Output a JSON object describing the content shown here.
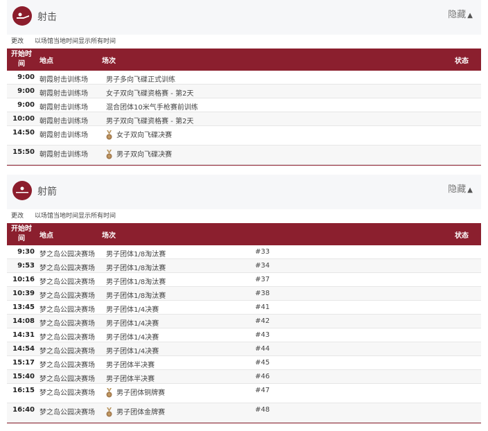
{
  "colors": {
    "accent": "#8b1f2e",
    "medal": "#a27a4e"
  },
  "sections": [
    {
      "id": "shooting",
      "title": "射击",
      "icon": "shooting-icon",
      "hide_label": "隐藏",
      "change_label": "更改",
      "timezone_note": "以场馆当地时间显示所有时间",
      "headers": {
        "time": "开始时间",
        "venue": "地点",
        "event": "场次",
        "status": "状态"
      },
      "rows": [
        {
          "time": "9:00",
          "venue": "朝霞射击训练场",
          "event": "男子多向飞碟正式训练",
          "medal": false,
          "num": ""
        },
        {
          "time": "9:00",
          "venue": "朝霞射击训练场",
          "event": "女子双向飞碟资格赛 - 第2天",
          "medal": false,
          "num": ""
        },
        {
          "time": "9:00",
          "venue": "朝霞射击训练场",
          "event": "混合团体10米气手枪赛前训练",
          "medal": false,
          "num": ""
        },
        {
          "time": "10:00",
          "venue": "朝霞射击训练场",
          "event": "男子双向飞碟资格赛 - 第2天",
          "medal": false,
          "num": ""
        },
        {
          "time": "14:50",
          "venue": "朝霞射击训练场",
          "event": "女子双向飞碟决赛",
          "medal": true,
          "num": ""
        },
        {
          "time": "15:50",
          "venue": "朝霞射击训练场",
          "event": "男子双向飞碟决赛",
          "medal": true,
          "num": ""
        }
      ]
    },
    {
      "id": "archery",
      "title": "射箭",
      "icon": "archery-icon",
      "hide_label": "隐藏",
      "change_label": "更改",
      "timezone_note": "以场馆当地时间显示所有时间",
      "headers": {
        "time": "开始时间",
        "venue": "地点",
        "event": "场次",
        "status": "状态"
      },
      "rows": [
        {
          "time": "9:30",
          "venue": "梦之岛公园决赛场",
          "event": "男子团体1/8淘汰赛",
          "medal": false,
          "num": "#33"
        },
        {
          "time": "9:53",
          "venue": "梦之岛公园决赛场",
          "event": "男子团体1/8淘汰赛",
          "medal": false,
          "num": "#34"
        },
        {
          "time": "10:16",
          "venue": "梦之岛公园决赛场",
          "event": "男子团体1/8淘汰赛",
          "medal": false,
          "num": "#37"
        },
        {
          "time": "10:39",
          "venue": "梦之岛公园决赛场",
          "event": "男子团体1/8淘汰赛",
          "medal": false,
          "num": "#38"
        },
        {
          "time": "13:45",
          "venue": "梦之岛公园决赛场",
          "event": "男子团体1/4决赛",
          "medal": false,
          "num": "#41"
        },
        {
          "time": "14:08",
          "venue": "梦之岛公园决赛场",
          "event": "男子团体1/4决赛",
          "medal": false,
          "num": "#42"
        },
        {
          "time": "14:31",
          "venue": "梦之岛公园决赛场",
          "event": "男子团体1/4决赛",
          "medal": false,
          "num": "#43"
        },
        {
          "time": "14:54",
          "venue": "梦之岛公园决赛场",
          "event": "男子团体1/4决赛",
          "medal": false,
          "num": "#44"
        },
        {
          "time": "15:17",
          "venue": "梦之岛公园决赛场",
          "event": "男子团体半决赛",
          "medal": false,
          "num": "#45"
        },
        {
          "time": "15:40",
          "venue": "梦之岛公园决赛场",
          "event": "男子团体半决赛",
          "medal": false,
          "num": "#46"
        },
        {
          "time": "16:15",
          "venue": "梦之岛公园决赛场",
          "event": "男子团体铜牌赛",
          "medal": true,
          "num": "#47"
        },
        {
          "time": "16:40",
          "venue": "梦之岛公园决赛场",
          "event": "男子团体金牌赛",
          "medal": true,
          "num": "#48"
        }
      ]
    }
  ]
}
